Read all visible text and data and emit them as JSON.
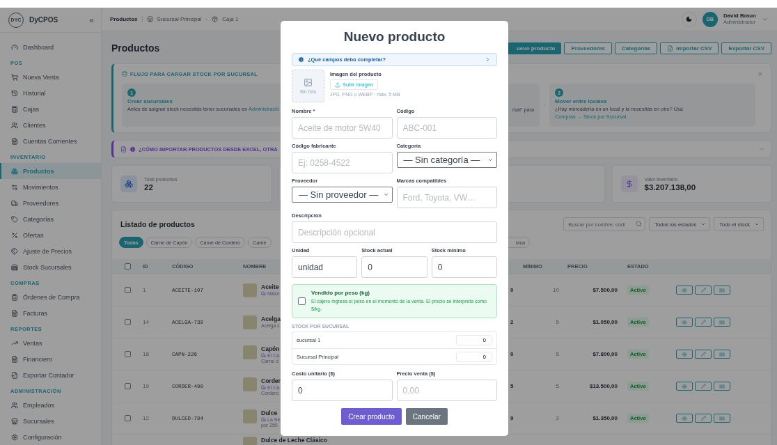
{
  "sidebar": {
    "logo": "DYC",
    "brand": "DyCPOS",
    "collapse": "«",
    "nav": [
      {
        "kind": "link",
        "label": "Dashboard",
        "selected": false
      },
      {
        "kind": "section",
        "label": "POS"
      },
      {
        "kind": "link",
        "label": "Nueva Venta",
        "selected": false
      },
      {
        "kind": "link",
        "label": "Historial",
        "selected": false
      },
      {
        "kind": "link",
        "label": "Cajas",
        "selected": false
      },
      {
        "kind": "link",
        "label": "Clientes",
        "selected": false
      },
      {
        "kind": "link",
        "label": "Cuentas Corrientes",
        "selected": false
      },
      {
        "kind": "section",
        "label": "INVENTARIO"
      },
      {
        "kind": "link",
        "label": "Productos",
        "selected": true
      },
      {
        "kind": "link",
        "label": "Movimientos",
        "selected": false
      },
      {
        "kind": "link",
        "label": "Proveedores",
        "selected": false
      },
      {
        "kind": "link",
        "label": "Categorías",
        "selected": false
      },
      {
        "kind": "link",
        "label": "Ofertas",
        "selected": false
      },
      {
        "kind": "link",
        "label": "Ajuste de Precios",
        "selected": false
      },
      {
        "kind": "link",
        "label": "Stock Sucursales",
        "selected": false
      },
      {
        "kind": "section",
        "label": "COMPRAS"
      },
      {
        "kind": "link",
        "label": "Órdenes de Compra",
        "selected": false
      },
      {
        "kind": "link",
        "label": "Facturas",
        "selected": false
      },
      {
        "kind": "section",
        "label": "REPORTES"
      },
      {
        "kind": "link",
        "label": "Ventas",
        "selected": false
      },
      {
        "kind": "link",
        "label": "Financiero",
        "selected": false
      },
      {
        "kind": "link",
        "label": "Exportar Contador",
        "selected": false
      },
      {
        "kind": "section",
        "label": "ADMINISTRACIÓN"
      },
      {
        "kind": "link",
        "label": "Empleados",
        "selected": false
      },
      {
        "kind": "link",
        "label": "Sucursales",
        "selected": false
      },
      {
        "kind": "link",
        "label": "Configuración",
        "selected": false
      }
    ]
  },
  "breadcrumb": {
    "page": "Productos",
    "branch": "Sucursal Principal",
    "separator": "·",
    "register": "Caja 1"
  },
  "user": {
    "initials": "DB",
    "name": "David Braun",
    "role": "Administrador"
  },
  "page_title": "Productos",
  "actions": [
    {
      "label": "uevo producto",
      "kind": "primary"
    },
    {
      "label": "Proveedores",
      "kind": "outline"
    },
    {
      "label": "Categorías",
      "kind": "outline"
    },
    {
      "label": "Importar CSV",
      "kind": "import"
    },
    {
      "label": "Exportar CSV",
      "kind": "outline"
    }
  ],
  "flow": {
    "title": "FLUJO PARA CARGAR STOCK POR SUCURSAL",
    "close": "×",
    "steps": [
      {
        "number": "1",
        "title": "Crear sucursales",
        "text": "Antes de asignar stock necesitás tener sucursales en ",
        "link": "Administració"
      },
      {
        "text": "rsal\" para"
      },
      {
        "number": "3",
        "title": "Mover entre locales",
        "text": "¿Hay mercadería en un local y la necesitás en otro? Usá ",
        "link": "Compras → Stock por Sucursal"
      }
    ]
  },
  "import_tip": {
    "title": "¿CÓMO IMPORTAR PRODUCTOS DESDE EXCEL, OTRA"
  },
  "stats": [
    {
      "label": "Total productos",
      "value": "22",
      "kind": "count"
    },
    {
      "label": "Valor inventario",
      "value": "$3.207.138,00",
      "kind": "money"
    }
  ],
  "list": {
    "title": "Listado de productos",
    "search_placeholder": "Buscar por nombre, códi",
    "filters": [
      "Todos los estados",
      "Todo el stock"
    ],
    "chips": [
      {
        "label": "Todas",
        "selected": true
      },
      {
        "label": "Carne de Capón",
        "selected": false
      },
      {
        "label": "Carne de Cordero",
        "selected": false
      },
      {
        "label": "Carne",
        "selected": false
      },
      {
        "label": "nica",
        "selected": false
      }
    ],
    "all_selected": false,
    "columns": [
      "ID",
      "CÓDIGO",
      "NOMBRE",
      "MÍNIMO",
      "PRECIO",
      "ESTADO"
    ],
    "rows": [
      {
        "selected": false,
        "id": "1",
        "code": "ACEITE-107",
        "name": "Aceite",
        "supplier": "Natur",
        "stock": "0",
        "min": "10",
        "price": "$7.500,00",
        "status": "Activo"
      },
      {
        "selected": false,
        "id": "14",
        "code": "ACELGA-739",
        "name": "Acelga",
        "note": "Acelga c",
        "stock": "2",
        "min": "5",
        "price": "$1.050,00",
        "status": "Activo"
      },
      {
        "selected": false,
        "id": "18",
        "code": "CAPN-226",
        "name": "Capón",
        "supplier": "El Ca",
        "note": "Carne d",
        "stock": "0",
        "min": "5",
        "price": "$7.800,00",
        "status": "Activo"
      },
      {
        "selected": false,
        "id": "19",
        "code": "CORDER-490",
        "name": "Corder",
        "supplier": "El Ca",
        "note": "Cordero",
        "stock": "5",
        "min": "5",
        "price": "$13.500,00",
        "status": "Activo"
      },
      {
        "selected": false,
        "id": "12",
        "code": "DULCED-794",
        "name": "Dulce",
        "supplier": "La Se",
        "note": "por 250",
        "stock": "9",
        "min": "2",
        "price": "$1.350,00",
        "status": "Activo"
      },
      {
        "name": "Dulce de Leche Clásico"
      }
    ]
  },
  "modal": {
    "title": "Nuevo producto",
    "help": "¿Qué campos debo completar?",
    "image": {
      "empty": "Sin foto",
      "label": "Imagen del producto",
      "upload": "Subir imagen",
      "hint": "JPG, PNG o WEBP · máx. 5 MB"
    },
    "fields": [
      {
        "label": "Nombre *",
        "kind": "input",
        "placeholder": "Aceite de motor 5W40"
      },
      {
        "label": "Código",
        "kind": "input",
        "placeholder": "ABC-001"
      },
      {
        "label": "Código fabricante",
        "kind": "input",
        "placeholder": "Ej: 0258-4522"
      },
      {
        "label": "Categoría",
        "kind": "select",
        "value": "— Sin categoría —"
      },
      {
        "label": "Proveedor",
        "kind": "select",
        "value": "— Sin proveedor —"
      },
      {
        "label": "Marcas compatibles",
        "kind": "input",
        "placeholder": "Ford, Toyota, VW…"
      },
      {
        "label": "Descripción",
        "kind": "input",
        "placeholder": "Descripción opcional",
        "wide": true
      }
    ],
    "stock_fields": [
      {
        "label": "Unidad",
        "value": "unidad"
      },
      {
        "label": "Stock actual",
        "value": "0"
      },
      {
        "label": "Stock mínimo",
        "value": "0"
      }
    ],
    "weight": {
      "title": "Vendido por peso (kg)",
      "text": "El cajero ingresa el peso en el momento de la venta. El precio se interpreta como $/kg.",
      "checked": false
    },
    "branch_stock": {
      "title": "STOCK POR SUCURSAL",
      "rows": [
        {
          "name": "sucursal 1",
          "value": "0"
        },
        {
          "name": "Sucursal Principal",
          "value": "0"
        }
      ]
    },
    "price_fields": [
      {
        "label": "Costo unitario ($)",
        "value": "0"
      },
      {
        "label": "Precio venta ($)",
        "placeholder": "0.00"
      }
    ],
    "buttons": [
      {
        "label": "Crear producto",
        "kind": "primary"
      },
      {
        "label": "Cancelar",
        "kind": "secondary"
      }
    ]
  }
}
